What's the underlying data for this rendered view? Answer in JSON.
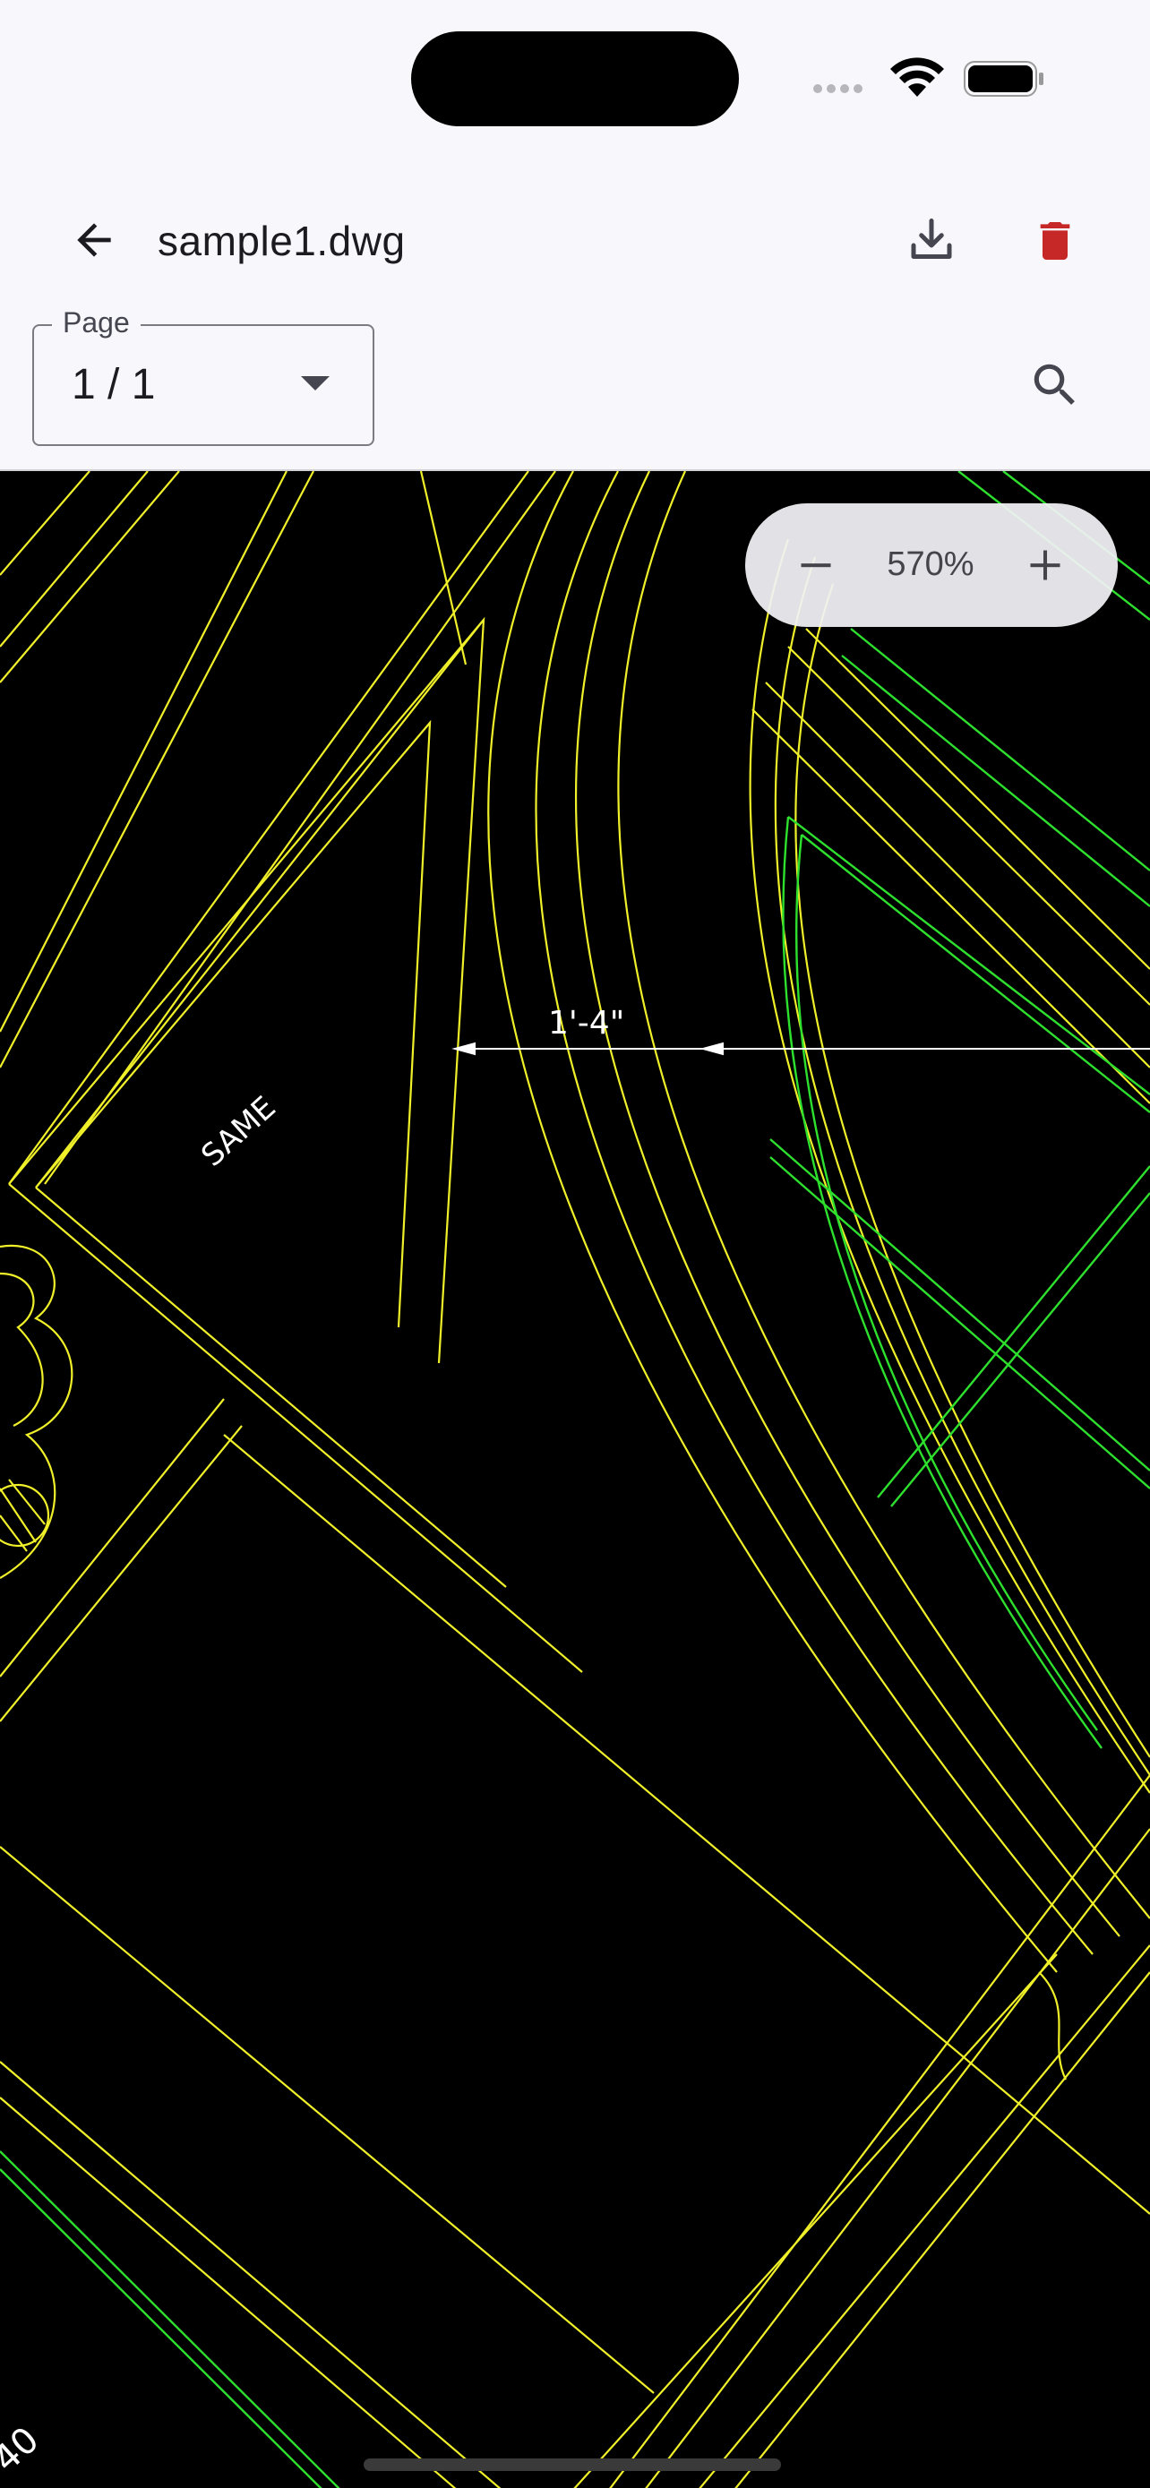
{
  "app_bar": {
    "title": "sample1.dwg",
    "back_icon": "arrow-back-icon",
    "download_icon": "download-icon",
    "delete_icon": "trash-icon",
    "delete_color": "#c62828"
  },
  "page_selector": {
    "label": "Page",
    "value": "1 / 1"
  },
  "search": {
    "icon": "search-icon"
  },
  "zoom": {
    "level": "570%",
    "minus_icon": "minus-icon",
    "plus_icon": "plus-icon"
  },
  "drawing": {
    "background": "#000000",
    "line_colors": [
      "#f0f02a",
      "#2ee02e",
      "#ffffff"
    ],
    "dimension_label": "1'-4\"",
    "note_label": "SAME",
    "corner_label": "40"
  }
}
